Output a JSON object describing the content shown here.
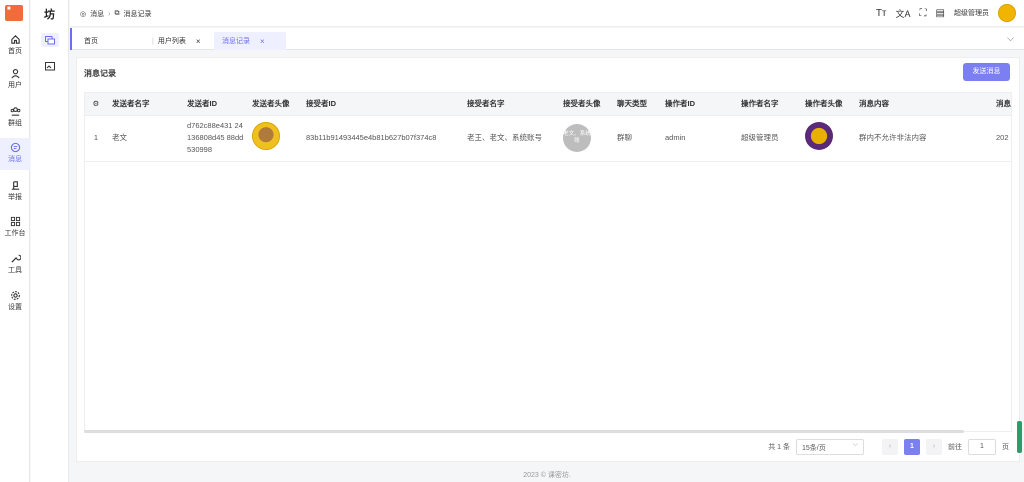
{
  "rail": {
    "items": [
      {
        "label": "首页",
        "icon": "home-icon"
      },
      {
        "label": "用户",
        "icon": "user-icon"
      },
      {
        "label": "群组",
        "icon": "group-icon"
      },
      {
        "label": "消息",
        "icon": "message-icon"
      },
      {
        "label": "举报",
        "icon": "report-icon"
      },
      {
        "label": "工作台",
        "icon": "grid-icon"
      },
      {
        "label": "工具",
        "icon": "wrench-icon"
      },
      {
        "label": "设置",
        "icon": "gear-icon"
      }
    ],
    "active_index": 3
  },
  "rail2": {
    "title": "坊"
  },
  "header": {
    "breadcrumb": [
      "消息",
      "消息记录"
    ],
    "user_name": "超级管理员"
  },
  "tabs": [
    {
      "label": "首页"
    },
    {
      "label": "用户列表"
    },
    {
      "label": "消息记录"
    }
  ],
  "page": {
    "title": "消息记录",
    "send_button": "发送消息"
  },
  "table": {
    "columns": [
      "发送者名字",
      "发送者ID",
      "发送者头像",
      "接受者ID",
      "接受者名字",
      "接受者头像",
      "聊天类型",
      "操作者ID",
      "操作者名字",
      "操作者头像",
      "消息内容",
      "消息"
    ],
    "rows": [
      {
        "index": "1",
        "sender_name": "老文",
        "sender_id": "d762c88e431 24136808d45 88dd530998",
        "receiver_id": "83b11b91493445e4b81b627b07f374c8",
        "receiver_name": "老王、老文、系统账号",
        "receiver_avatar_text": "老文、系统账",
        "chat_type": "群聊",
        "operator_id": "admin",
        "operator_name": "超级管理员",
        "content": "群内不允许非法内容",
        "time": "202"
      }
    ]
  },
  "pager": {
    "total": "共 1 条",
    "page_size": "15条/页",
    "current": "1",
    "goto_label": "前往",
    "goto_value": "1",
    "page_suffix": "页"
  },
  "footer": "2023 © 课密坊."
}
